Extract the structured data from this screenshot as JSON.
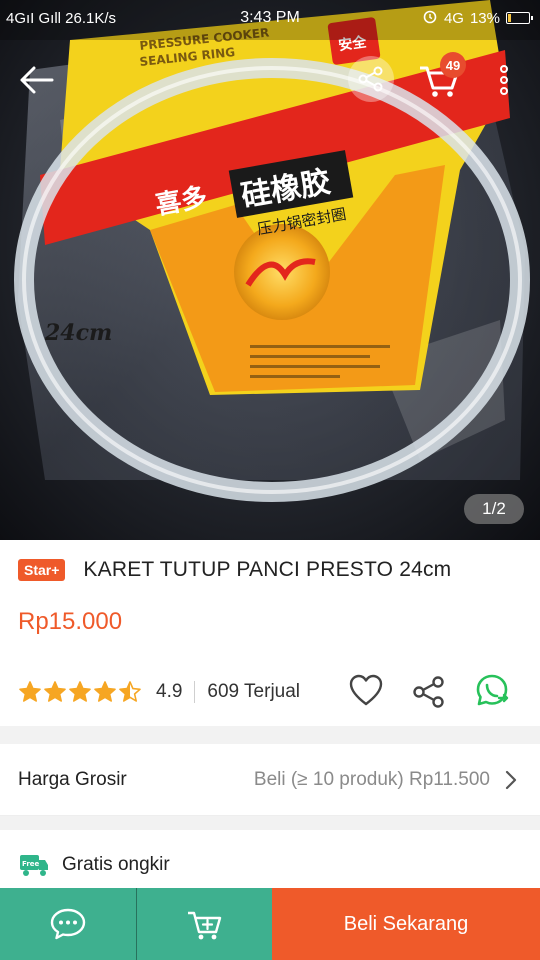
{
  "status_bar": {
    "left": "4GıI Gıll 26.1K/s",
    "time": "3:43 PM",
    "network": "4G",
    "battery": "13%"
  },
  "header": {
    "cart_count": "49"
  },
  "gallery": {
    "counter": "1/2",
    "package": {
      "tag_line1": "PRESSURE COOKER",
      "tag_line2": "SEALING RING",
      "brand": "喜多",
      "product": "硅橡胶",
      "sub": "压力锅密封圈",
      "corner": "安全",
      "size_label": "24cm"
    }
  },
  "product": {
    "badge": "Star+",
    "title": "KARET TUTUP PANCI PRESTO 24cm",
    "price": "Rp15.000",
    "rating": 4.5,
    "rating_text": "4.9",
    "sold": "609 Terjual"
  },
  "wholesale": {
    "label": "Harga Grosir",
    "value": "Beli (≥ 10 produk) Rp11.500"
  },
  "shipping": {
    "truck_tag": "Free",
    "label": "Gratis ongkir"
  },
  "bottom_bar": {
    "buy_label": "Beli Sekarang"
  },
  "colors": {
    "accent": "#ef5a2a",
    "green": "#3eb08f",
    "star": "#f6a623",
    "whatsapp": "#27c15a"
  },
  "icons": [
    "back-arrow-icon",
    "share-icon",
    "cart-icon",
    "more-vert-icon",
    "star-icon",
    "heart-icon",
    "whatsapp-icon",
    "chevron-right-icon",
    "truck-icon",
    "chat-icon",
    "add-cart-icon"
  ]
}
